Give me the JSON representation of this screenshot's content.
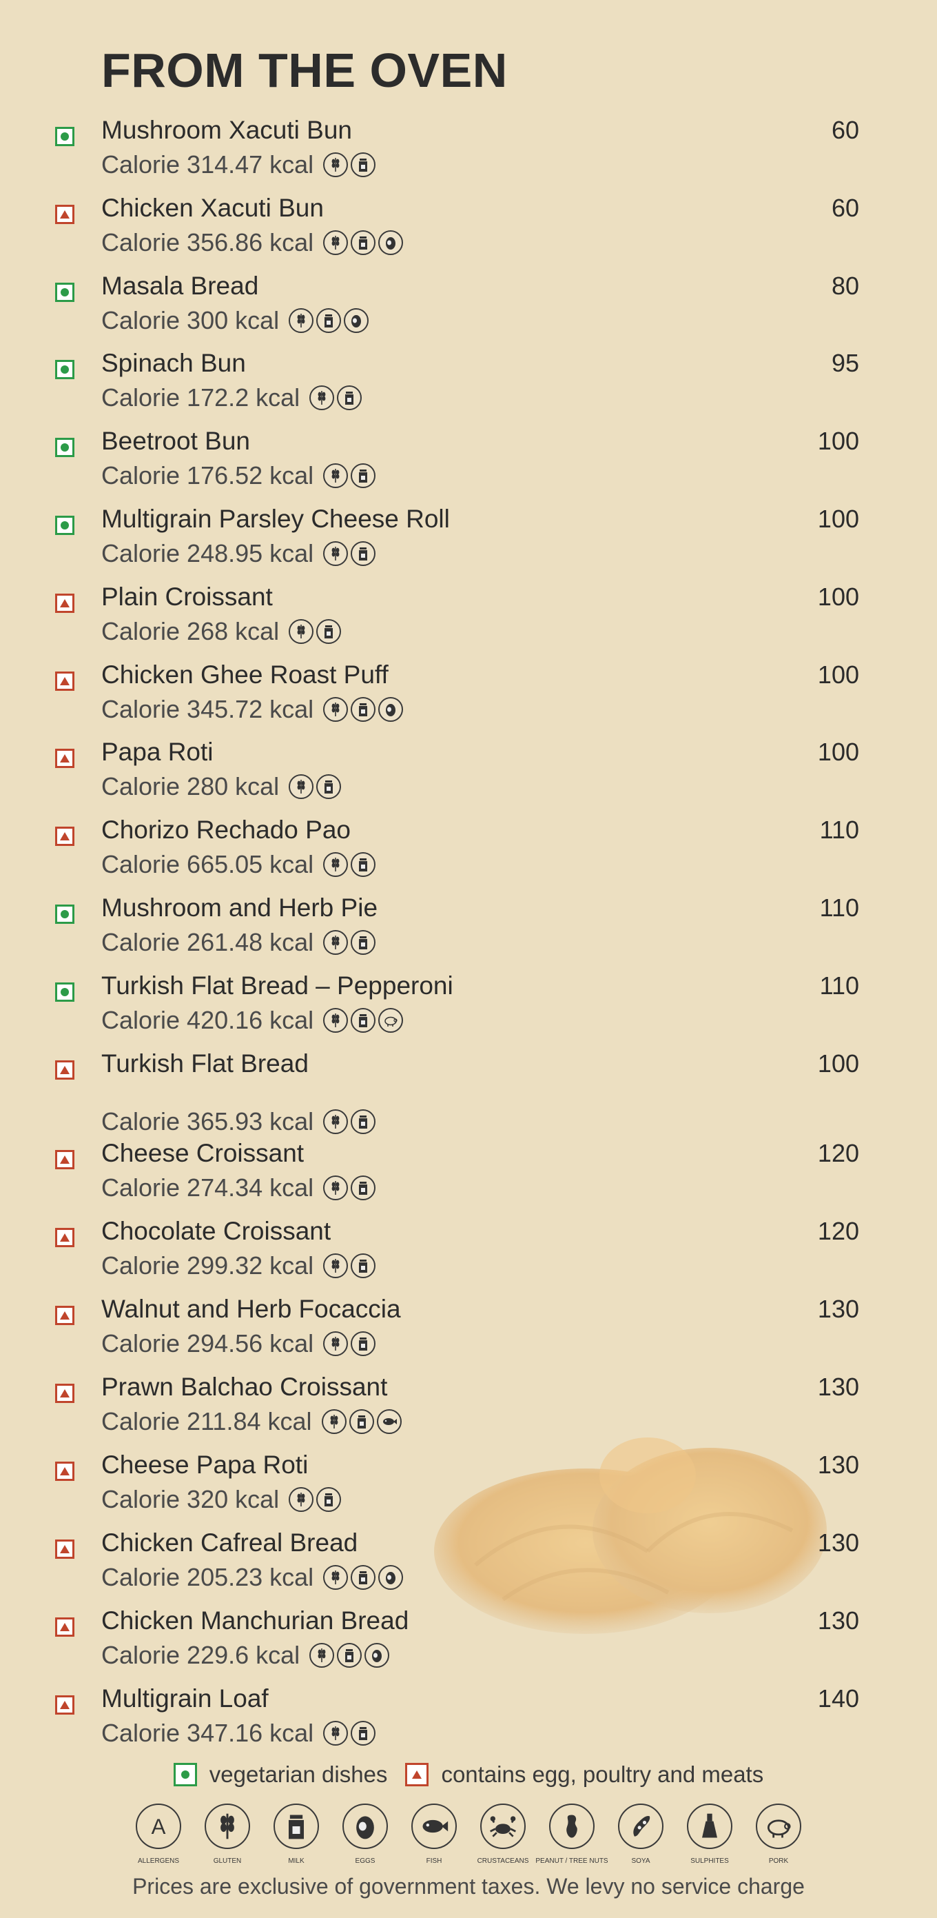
{
  "title": "FROM THE OVEN",
  "items": [
    {
      "name": "Mushroom Xacuti Bun",
      "calorie": "Calorie 314.47 kcal",
      "price": "60",
      "type": "veg",
      "allergens": [
        "gluten-icon",
        "milk-icon"
      ]
    },
    {
      "name": "Chicken Xacuti Bun",
      "calorie": "Calorie 356.86 kcal",
      "price": "60",
      "type": "nonveg",
      "allergens": [
        "gluten-icon",
        "milk-icon",
        "eggs-icon"
      ]
    },
    {
      "name": "Masala Bread",
      "calorie": "Calorie 300 kcal",
      "price": "80",
      "type": "veg",
      "allergens": [
        "gluten-icon",
        "milk-icon",
        "eggs-icon"
      ]
    },
    {
      "name": "Spinach Bun",
      "calorie": "Calorie 172.2 kcal",
      "price": "95",
      "type": "veg",
      "allergens": [
        "gluten-icon",
        "milk-icon"
      ]
    },
    {
      "name": "Beetroot Bun",
      "calorie": "Calorie 176.52 kcal",
      "price": "100",
      "type": "veg",
      "allergens": [
        "gluten-icon",
        "milk-icon"
      ]
    },
    {
      "name": "Multigrain Parsley Cheese Roll",
      "calorie": "Calorie 248.95 kcal",
      "price": "100",
      "type": "veg",
      "allergens": [
        "gluten-icon",
        "milk-icon"
      ]
    },
    {
      "name": "Plain Croissant",
      "calorie": "Calorie 268 kcal",
      "price": "100",
      "type": "nonveg",
      "allergens": [
        "gluten-icon",
        "milk-icon"
      ]
    },
    {
      "name": "Chicken Ghee Roast Puff",
      "calorie": "Calorie 345.72 kcal",
      "price": "100",
      "type": "nonveg",
      "allergens": [
        "gluten-icon",
        "milk-icon",
        "eggs-icon"
      ]
    },
    {
      "name": "Papa Roti",
      "calorie": "Calorie 280 kcal",
      "price": "100",
      "type": "nonveg",
      "allergens": [
        "gluten-icon",
        "milk-icon"
      ]
    },
    {
      "name": "Chorizo Rechado Pao",
      "calorie": "Calorie 665.05 kcal",
      "price": "110",
      "type": "nonveg",
      "allergens": [
        "gluten-icon",
        "milk-icon"
      ]
    },
    {
      "name": "Mushroom and Herb Pie",
      "calorie": "Calorie 261.48 kcal",
      "price": "110",
      "type": "veg",
      "allergens": [
        "gluten-icon",
        "milk-icon"
      ]
    },
    {
      "name": "Turkish Flat Bread – Pepperoni",
      "calorie": "Calorie 420.16 kcal",
      "price": "110",
      "type": "veg",
      "allergens": [
        "gluten-icon",
        "milk-icon",
        "pork-icon"
      ]
    },
    {
      "name": "Turkish Flat Bread",
      "calorie": "Calorie 365.93 kcal",
      "price": "100",
      "type": "nonveg",
      "allergens": [
        "gluten-icon",
        "milk-icon"
      ]
    },
    {
      "name": "Cheese Croissant",
      "calorie": "Calorie 274.34 kcal",
      "price": "120",
      "type": "nonveg",
      "allergens": [
        "gluten-icon",
        "milk-icon"
      ]
    },
    {
      "name": "Chocolate Croissant",
      "calorie": "Calorie 299.32 kcal",
      "price": "120",
      "type": "nonveg",
      "allergens": [
        "gluten-icon",
        "milk-icon"
      ]
    },
    {
      "name": "Walnut and Herb Focaccia",
      "calorie": "Calorie 294.56 kcal",
      "price": "130",
      "type": "nonveg",
      "allergens": [
        "gluten-icon",
        "milk-icon"
      ]
    },
    {
      "name": "Prawn Balchao Croissant",
      "calorie": "Calorie 211.84 kcal",
      "price": "130",
      "type": "nonveg",
      "allergens": [
        "gluten-icon",
        "milk-icon",
        "fish-icon"
      ]
    },
    {
      "name": "Cheese Papa Roti",
      "calorie": "Calorie 320 kcal",
      "price": "130",
      "type": "nonveg",
      "allergens": [
        "gluten-icon",
        "milk-icon"
      ]
    },
    {
      "name": "Chicken Cafreal Bread",
      "calorie": "Calorie 205.23 kcal",
      "price": "130",
      "type": "nonveg",
      "allergens": [
        "gluten-icon",
        "milk-icon",
        "eggs-icon"
      ]
    },
    {
      "name": "Chicken Manchurian Bread",
      "calorie": "Calorie 229.6 kcal",
      "price": "130",
      "type": "nonveg",
      "allergens": [
        "gluten-icon",
        "milk-icon",
        "eggs-icon"
      ]
    },
    {
      "name": "Multigrain Loaf",
      "calorie": "Calorie 347.16 kcal",
      "price": "140",
      "type": "nonveg",
      "allergens": [
        "gluten-icon",
        "milk-icon"
      ]
    }
  ],
  "legend": {
    "veg": "vegetarian dishes",
    "nonveg": "contains egg, poultry and meats"
  },
  "allergen_key": [
    {
      "icon": "allergens-icon",
      "label": "ALLERGENS"
    },
    {
      "icon": "gluten-icon",
      "label": "GLUTEN"
    },
    {
      "icon": "milk-icon",
      "label": "MILK"
    },
    {
      "icon": "eggs-icon",
      "label": "EGGS"
    },
    {
      "icon": "fish-icon",
      "label": "FISH"
    },
    {
      "icon": "crustaceans-icon",
      "label": "CRUSTACEANS"
    },
    {
      "icon": "peanut-icon",
      "label": "PEANUT / TREE NUTS"
    },
    {
      "icon": "soya-icon",
      "label": "SOYA"
    },
    {
      "icon": "sulphites-icon",
      "label": "SULPHITES"
    },
    {
      "icon": "pork-icon",
      "label": "PORK"
    }
  ],
  "footer": "Prices are exclusive of government taxes. We levy no service charge",
  "colors": {
    "background": "#ecdfc1",
    "veg": "#2c9b48",
    "nonveg": "#c0452c"
  }
}
